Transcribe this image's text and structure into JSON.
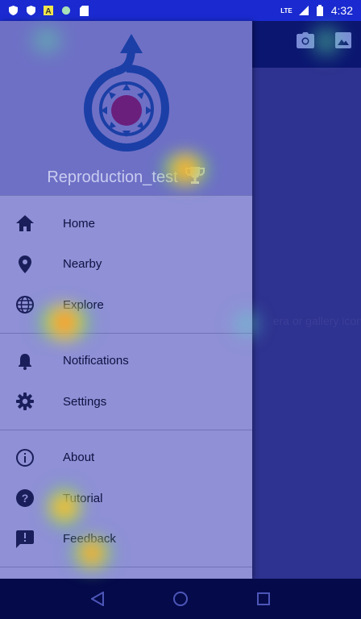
{
  "status_bar": {
    "network": "LTE",
    "time": "4:32",
    "notification_icons": [
      "shield-icon",
      "shield-icon",
      "font-a-icon",
      "circle-icon",
      "sd-card-icon"
    ]
  },
  "app_bar": {
    "actions": [
      "camera-icon",
      "gallery-icon"
    ]
  },
  "main": {
    "hint_text": "era or gallery icon"
  },
  "drawer": {
    "username": "Reproduction_test",
    "sections": [
      [
        {
          "label": "Home",
          "icon": "home-icon"
        },
        {
          "label": "Nearby",
          "icon": "location-pin-icon"
        },
        {
          "label": "Explore",
          "icon": "globe-icon"
        }
      ],
      [
        {
          "label": "Notifications",
          "icon": "bell-icon"
        },
        {
          "label": "Settings",
          "icon": "gear-icon"
        }
      ],
      [
        {
          "label": "About",
          "icon": "info-icon"
        },
        {
          "label": "Tutorial",
          "icon": "help-icon"
        },
        {
          "label": "Feedback",
          "icon": "feedback-icon"
        }
      ]
    ]
  },
  "nav_bar": {
    "buttons": [
      "back-icon",
      "home-circle-icon",
      "recents-icon"
    ]
  },
  "colors": {
    "status_bar": "#1a2ad0",
    "app_bar": "#0b1670",
    "drawer": "#8f90d6",
    "drawer_header": "#6e70c6",
    "icon": "#1a1e5a",
    "nav_bar": "#050a4a"
  }
}
